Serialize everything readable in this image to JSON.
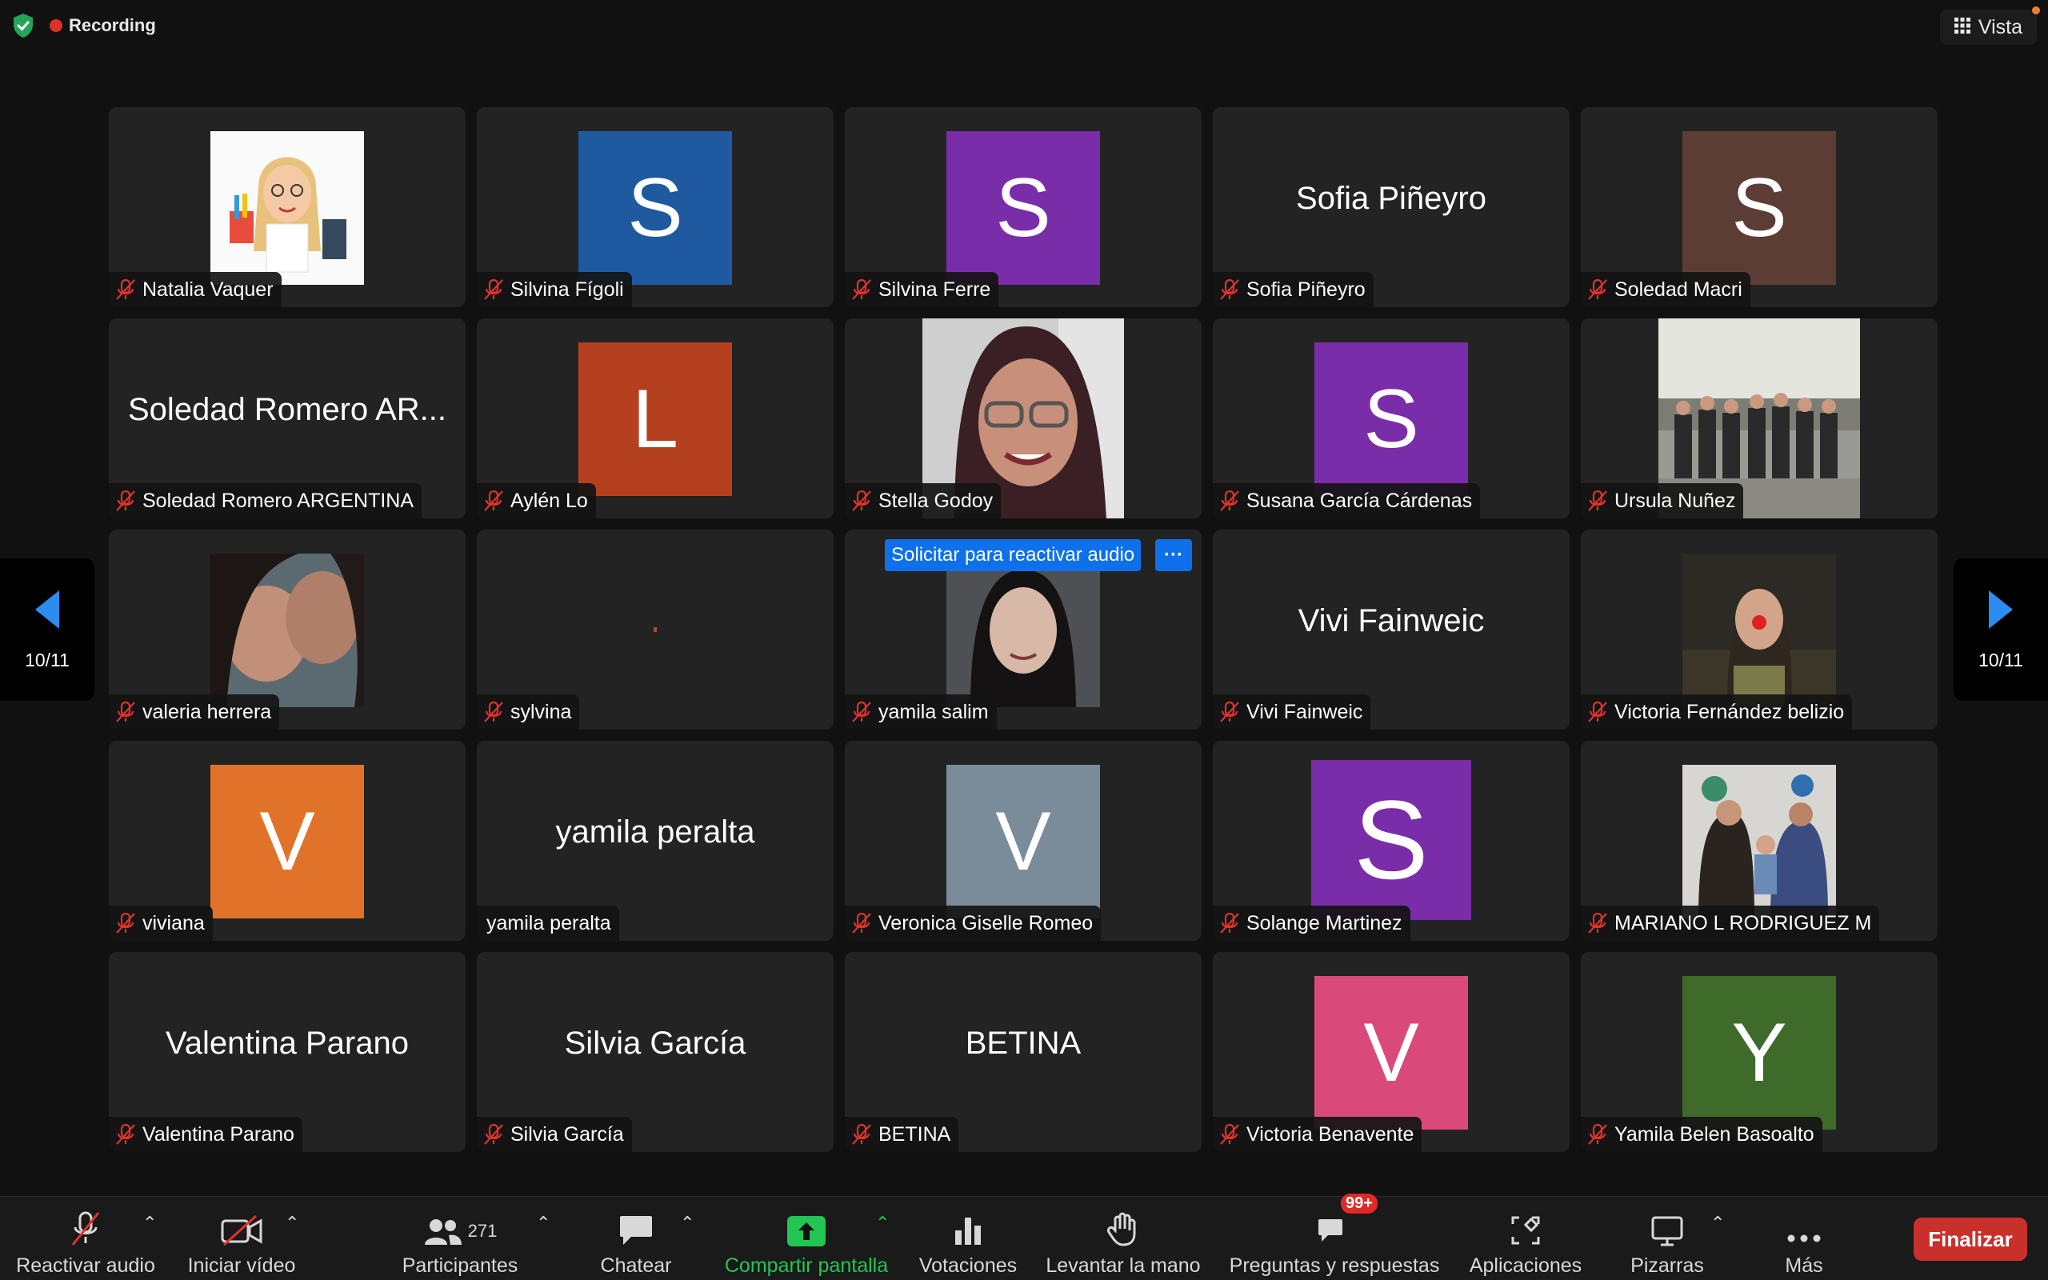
{
  "top": {
    "recording_label": "Recording",
    "view_label": "Vista"
  },
  "nav": {
    "left_page": "10/11",
    "right_page": "10/11"
  },
  "request_unmute": {
    "label": "Solicitar para reactivar audio",
    "more": "···"
  },
  "participants": [
    {
      "name": "Natalia Vaquer",
      "kind": "photo",
      "photo": "bitmoji"
    },
    {
      "name": "Silvina Fígoli",
      "kind": "letter",
      "letter": "S",
      "color": "#1f5aa0"
    },
    {
      "name": "Silvina Ferre",
      "kind": "letter",
      "letter": "S",
      "color": "#7a2da8"
    },
    {
      "name": "Sofia Piñeyro",
      "kind": "text",
      "display": "Sofia Piñeyro"
    },
    {
      "name": "Soledad Macri",
      "kind": "letter",
      "letter": "S",
      "color": "#5c3d35"
    },
    {
      "name": "Soledad Romero ARGENTINA",
      "kind": "text",
      "display": "Soledad Romero AR..."
    },
    {
      "name": "Aylén Lo",
      "kind": "letter",
      "letter": "L",
      "color": "#b5401f"
    },
    {
      "name": "Stella Godoy",
      "kind": "photo",
      "photo": "portrait-glasses"
    },
    {
      "name": "Susana García Cárdenas",
      "kind": "letter",
      "letter": "S",
      "color": "#7a2da8"
    },
    {
      "name": "Ursula Nuñez",
      "kind": "photo",
      "photo": "group"
    },
    {
      "name": "valeria herrera",
      "kind": "photo",
      "photo": "faces"
    },
    {
      "name": "sylvina",
      "kind": "blank"
    },
    {
      "name": "yamila salim",
      "kind": "photo",
      "photo": "portrait-dark"
    },
    {
      "name": "Vivi Fainweic",
      "kind": "text",
      "display": "Vivi Fainweic"
    },
    {
      "name": "Victoria Fernández belizio",
      "kind": "photo",
      "photo": "clown"
    },
    {
      "name": "viviana",
      "kind": "letter",
      "letter": "V",
      "color": "#e0722a"
    },
    {
      "name": "yamila peralta",
      "kind": "text",
      "display": "yamila peralta",
      "unmuted": true
    },
    {
      "name": "Veronica Giselle Romeo",
      "kind": "letter",
      "letter": "V",
      "color": "#7a8c9a"
    },
    {
      "name": "Solange Martinez",
      "kind": "letter",
      "letter": "S",
      "color": "#7a2da8",
      "big": true
    },
    {
      "name": "MARIANO L RODRIGUEZ M",
      "kind": "photo",
      "photo": "family"
    },
    {
      "name": "Valentina Parano",
      "kind": "text",
      "display": "Valentina Parano"
    },
    {
      "name": "Silvia García",
      "kind": "text",
      "display": "Silvia García"
    },
    {
      "name": "BETINA",
      "kind": "text",
      "display": "BETINA"
    },
    {
      "name": "Victoria Benavente",
      "kind": "letter",
      "letter": "V",
      "color": "#d94a7a"
    },
    {
      "name": "Yamila Belen Basoalto",
      "kind": "letter",
      "letter": "Y",
      "color": "#3e6b2a"
    }
  ],
  "toolbar": {
    "unmute": "Reactivar audio",
    "start_video": "Iniciar vídeo",
    "participants": "Participantes",
    "participants_count": "271",
    "chat": "Chatear",
    "share_screen": "Compartir pantalla",
    "polls": "Votaciones",
    "raise_hand": "Levantar la mano",
    "qa": "Preguntas y respuestas",
    "qa_badge": "99+",
    "apps": "Aplicaciones",
    "whiteboards": "Pizarras",
    "more": "Más",
    "end": "Finalizar"
  }
}
